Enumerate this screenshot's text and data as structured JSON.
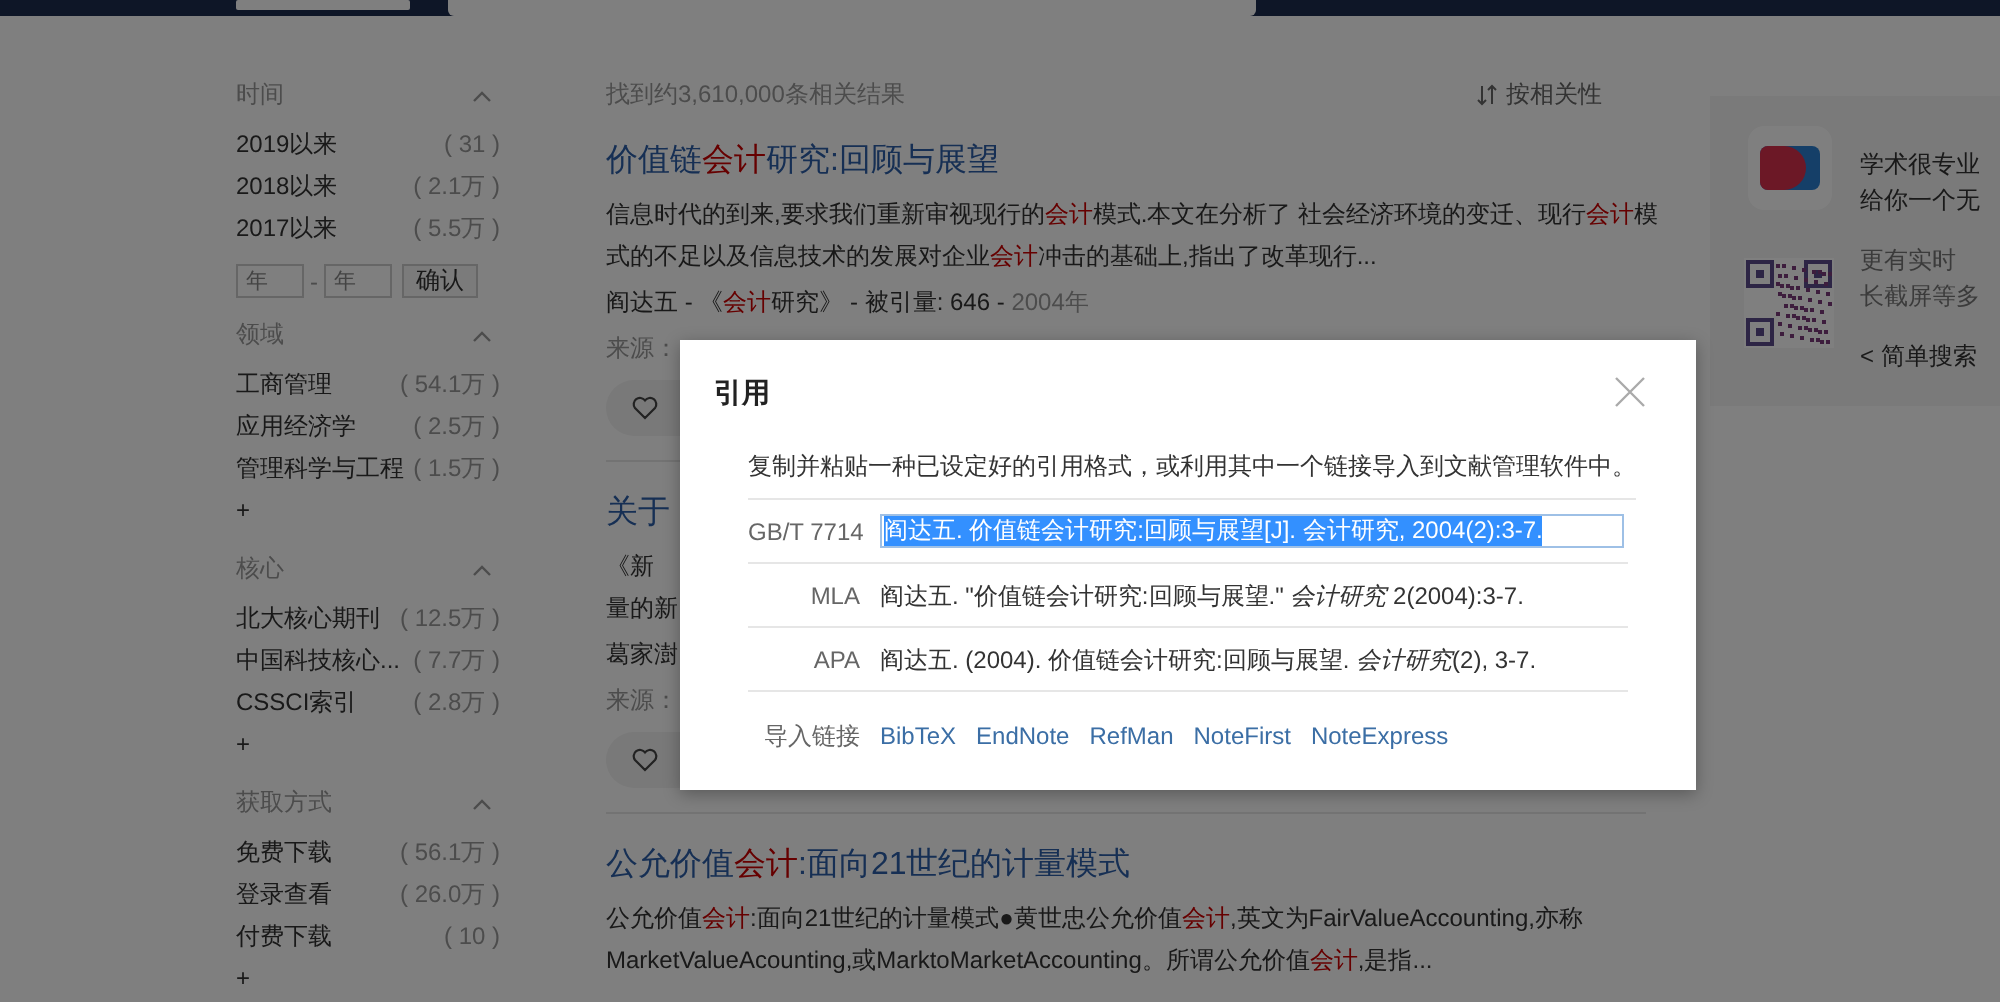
{
  "sidebar": {
    "sections": [
      {
        "title": "时间",
        "expanded": true,
        "items": [
          {
            "label": "2019以来",
            "count": "( 31 )"
          },
          {
            "label": "2018以来",
            "count": "( 2.1万 )"
          },
          {
            "label": "2017以来",
            "count": "( 5.5万 )"
          }
        ],
        "year_range": {
          "from_placeholder": "年",
          "separator": "-",
          "to_placeholder": "年",
          "button": "确认"
        }
      },
      {
        "title": "领域",
        "expanded": true,
        "items": [
          {
            "label": "工商管理",
            "count": "( 54.1万 )"
          },
          {
            "label": "应用经济学",
            "count": "( 2.5万 )"
          },
          {
            "label": "管理科学与工程",
            "count": "( 1.5万 )"
          }
        ],
        "more": "+"
      },
      {
        "title": "核心",
        "expanded": true,
        "items": [
          {
            "label": "北大核心期刊",
            "count": "( 12.5万 )"
          },
          {
            "label": "中国科技核心...",
            "count": "( 7.7万 )"
          },
          {
            "label": "CSSCI索引",
            "count": "( 2.8万 )"
          }
        ],
        "more": "+"
      },
      {
        "title": "获取方式",
        "expanded": true,
        "items": [
          {
            "label": "免费下载",
            "count": "( 56.1万 )"
          },
          {
            "label": "登录查看",
            "count": "( 26.0万 )"
          },
          {
            "label": "付费下载",
            "count": "( 10 )"
          }
        ],
        "more": "+"
      }
    ]
  },
  "results_summary": "找到约3,610,000条相关结果",
  "sort": {
    "label": "按相关性"
  },
  "results": [
    {
      "title": [
        {
          "text": "价值链",
          "highlight": false
        },
        {
          "text": "会计",
          "highlight": true
        },
        {
          "text": "研究:回顾与展望",
          "highlight": false
        }
      ],
      "abstract_lines": [
        [
          {
            "text": "信息时代的到来,要求我们重新审视现行的",
            "highlight": false
          },
          {
            "text": "会计",
            "highlight": true
          },
          {
            "text": "模式.本文在分析了 社会经济环境的变迁、现行",
            "highlight": false
          },
          {
            "text": "会计",
            "highlight": true
          },
          {
            "text": "模",
            "highlight": false
          }
        ],
        [
          {
            "text": "式的不足以及信息技术的发展对企业",
            "highlight": false
          },
          {
            "text": "会计",
            "highlight": true
          },
          {
            "text": "冲击的基础上,指出了改革现行...",
            "highlight": false
          }
        ]
      ],
      "meta": [
        {
          "text": "阎达五 - 《",
          "highlight": false
        },
        {
          "text": "会计",
          "highlight": true
        },
        {
          "text": "研究》 - 被引量: 646 - ",
          "highlight": false
        },
        {
          "text": "2004年",
          "highlight": false,
          "muted": true
        }
      ],
      "source_label": "来源：",
      "favorite_button": true
    },
    {
      "title": [
        {
          "text": "关于",
          "highlight": false
        }
      ],
      "abstract_lines": [
        [
          {
            "text": "《新",
            "highlight": false
          }
        ],
        [
          {
            "text": "量的新",
            "highlight": false
          }
        ]
      ],
      "meta": [
        {
          "text": "葛家澍",
          "highlight": false
        }
      ],
      "source_label": "来源：",
      "favorite_button": true
    },
    {
      "title": [
        {
          "text": "公允价值",
          "highlight": false
        },
        {
          "text": "会计",
          "highlight": true
        },
        {
          "text": ":面向21世纪的计量模式",
          "highlight": false
        }
      ],
      "abstract_lines": [
        [
          {
            "text": "公允价值",
            "highlight": false
          },
          {
            "text": "会计",
            "highlight": true
          },
          {
            "text": ":面向21世纪的计量模式●黄世忠公允价值",
            "highlight": false
          },
          {
            "text": "会计",
            "highlight": true
          },
          {
            "text": ",英文为FairValueAccounting,亦称",
            "highlight": false
          }
        ],
        [
          {
            "text": "MarketValueAcounting,或MarktoMarketAccounting。所谓公允价值",
            "highlight": false
          },
          {
            "text": "会计",
            "highlight": true
          },
          {
            "text": ",是指...",
            "highlight": false
          }
        ]
      ]
    }
  ],
  "promo": {
    "headline_lines": [
      "学术很专业",
      "给你一个无"
    ],
    "sub_lines": [
      "更有实时",
      "长截屏等多"
    ],
    "link": "< 简单搜索"
  },
  "citation_dialog": {
    "title": "引用",
    "description": "复制并粘贴一种已设定好的引用格式，或利用其中一个链接导入到文献管理软件中。",
    "formats": [
      {
        "label": "GB/T 7714",
        "kind": "field",
        "text": "阎达五. 价值链会计研究:回顾与展望[J]. 会计研究, 2004(2):3-7.",
        "selected": true
      },
      {
        "label": "MLA",
        "kind": "text",
        "text": "阎达五. \"价值链会计研究:回顾与展望.\" *会计研究* 2(2004):3-7."
      },
      {
        "label": "APA",
        "kind": "text",
        "text": "阎达五. (2004). 价值链会计研究:回顾与展望. *会计研究*(2), 3-7."
      }
    ],
    "import_label": "导入链接",
    "import_links": [
      "BibTeX",
      "EndNote",
      "RefMan",
      "NoteFirst",
      "NoteExpress"
    ]
  }
}
